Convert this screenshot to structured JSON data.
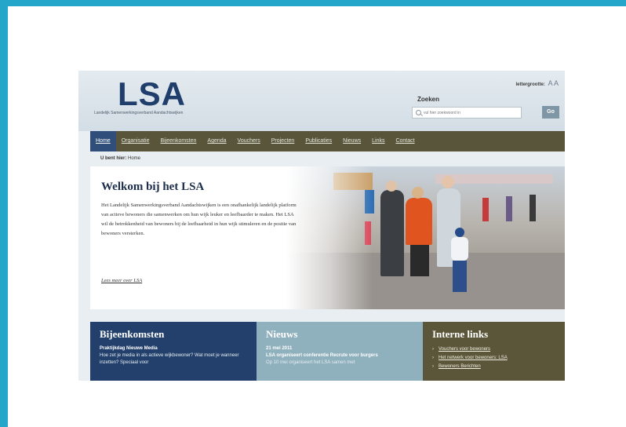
{
  "logo": {
    "text": "LSA",
    "subtitle": "Landelijk Samenwerkingsverband Aandachtswijken"
  },
  "header": {
    "font_size_label": "lettergrootte:",
    "font_size_toggle": "A A",
    "search_label": "Zoeken",
    "search_placeholder": "vul hier zoekwoord in",
    "search_button": "Go"
  },
  "nav": {
    "items": [
      "Home",
      "Organisatie",
      "Bijeenkomsten",
      "Agenda",
      "Vouchers",
      "Projecten",
      "Publicaties",
      "Nieuws",
      "Links",
      "Contact"
    ]
  },
  "breadcrumb": {
    "label": "U bent hier:",
    "current": "Home"
  },
  "hero": {
    "title": "Welkom bij het LSA",
    "text": "Het Landelijk Samenwerkingsverband Aandachtswijken is een onafhankelijk landelijk platform van actieve bewoners die samenwerken om hun wijk leuker en leefbaarder te maken. Het LSA wil de betrokkenheid van bewoners bij de leefbaarheid in hun wijk stimuleren en de positie van bewoners versterken.",
    "link": "Lees meer over LSA"
  },
  "boxes": {
    "events": {
      "title": "Bijeenkomsten",
      "subtitle": "Praktijkdag Nieuwe Media",
      "text": "Hoe zet je media in als actieve wijkbewoner? Wat moet je wanneer inzetten? Speciaal voor"
    },
    "news": {
      "title": "Nieuws",
      "date": "21 mei 2011",
      "headline": "LSA organiseert conferentie Recrute voor burgers",
      "text": "Op 10 mei organiseert het LSA samen met"
    },
    "links": {
      "title": "Interne links",
      "items": [
        "Vouchers voor bewoners",
        "Het netwerk voor bewoners: LSA",
        "Bewoners Berichten"
      ]
    }
  },
  "colors": {
    "frame": "#23a6c9",
    "nav": "#58553a",
    "nav_active": "#2f4f7a",
    "events_box": "#22406b",
    "news_box": "#8fb0bd",
    "links_box": "#5b5639"
  }
}
